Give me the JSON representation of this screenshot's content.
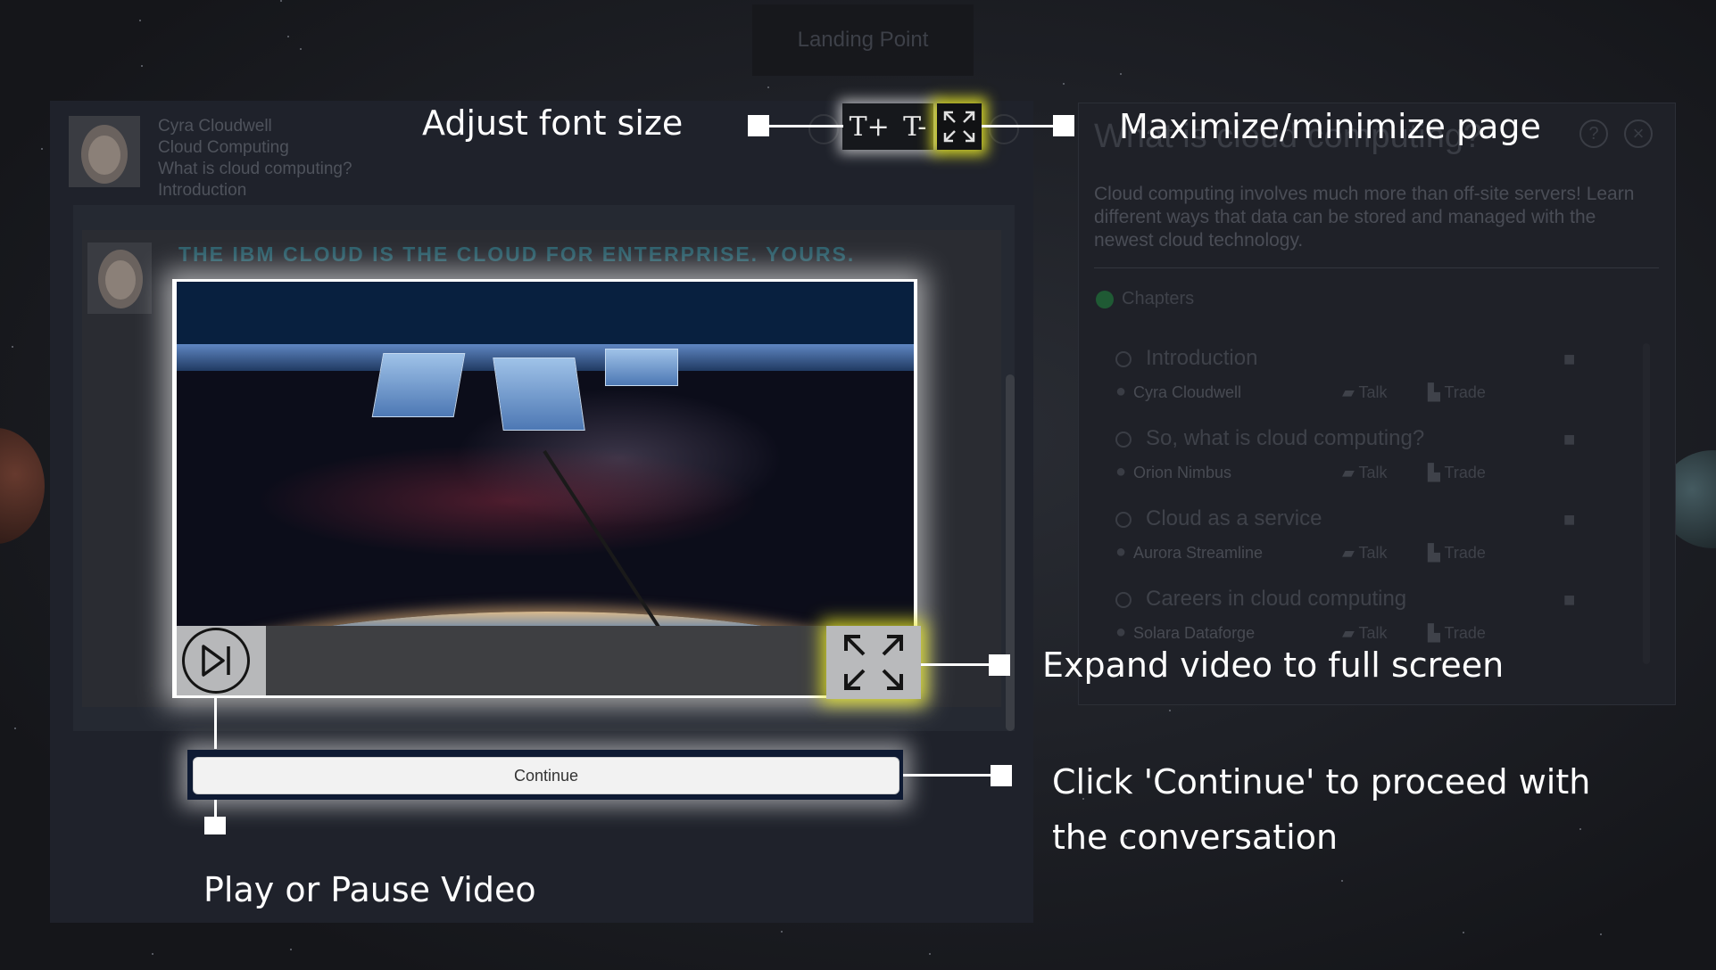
{
  "window": {
    "tab_title": "Landing Point"
  },
  "header": {
    "lines": [
      "Cyra Cloudwell",
      "Cloud Computing",
      "What is cloud computing?",
      "Introduction"
    ]
  },
  "chat": {
    "banner": "THE IBM CLOUD IS THE CLOUD FOR ENTERPRISE. YOURS."
  },
  "toolbar": {
    "font_increase": "T+",
    "font_decrease": "T-"
  },
  "video": {
    "continue_label": "Continue"
  },
  "side_panel": {
    "title": "What is cloud computing?",
    "description": "Cloud computing involves much more than off-site servers! Learn different ways that data can be stored and managed with the newest cloud technology.",
    "chapters_label": "Chapters",
    "chapters": [
      {
        "title": "Introduction",
        "person": "Cyra Cloudwell",
        "talk": "Talk",
        "trade": "Trade"
      },
      {
        "title": "So, what is cloud computing?",
        "person": "Orion Nimbus",
        "talk": "Talk",
        "trade": "Trade"
      },
      {
        "title": "Cloud as a service",
        "person": "Aurora Streamline",
        "talk": "Talk",
        "trade": "Trade"
      },
      {
        "title": "Careers in cloud computing",
        "person": "Solara Dataforge",
        "talk": "Talk",
        "trade": "Trade"
      }
    ]
  },
  "callouts": {
    "font_size": "Adjust font size",
    "maximize": "Maximize/minimize page",
    "expand": "Expand video to full screen",
    "continue_line1": "Click 'Continue' to proceed with",
    "continue_line2": "the conversation",
    "play_pause": "Play or Pause Video"
  },
  "icons": {
    "play": "play-pause-icon",
    "expand": "expand-icon",
    "maximize": "maximize-icon",
    "help": "help-icon",
    "close": "close-icon"
  },
  "colors": {
    "highlight_yellow": "#e6e628",
    "callout_text": "#ffffff"
  }
}
